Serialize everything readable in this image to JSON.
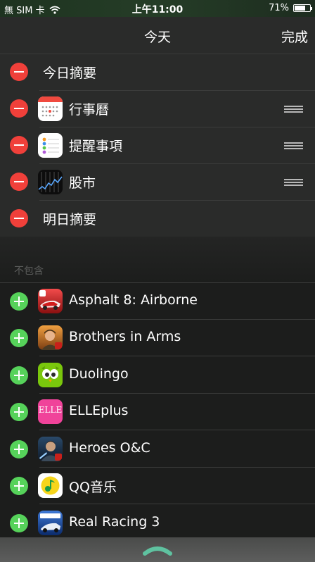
{
  "status_bar": {
    "carrier": "無 SIM 卡",
    "time": "上午11:00",
    "battery": "71%",
    "battery_level": 0.71
  },
  "nav": {
    "title": "今天",
    "done_label": "完成"
  },
  "included": [
    {
      "label": "今日摘要",
      "icon": "none",
      "reorderable": false
    },
    {
      "label": "行事曆",
      "icon": "calendar-icon",
      "reorderable": true
    },
    {
      "label": "提醒事項",
      "icon": "reminders-icon",
      "reorderable": true
    },
    {
      "label": "股市",
      "icon": "stocks-icon",
      "reorderable": true
    },
    {
      "label": "明日摘要",
      "icon": "none",
      "reorderable": false
    }
  ],
  "excluded_header": "不包含",
  "excluded": [
    {
      "label": "Asphalt 8: Airborne",
      "icon": "asphalt-8-icon"
    },
    {
      "label": "Brothers in Arms",
      "icon": "brothers-in-arms-icon"
    },
    {
      "label": "Duolingo",
      "icon": "duolingo-icon"
    },
    {
      "label": "ELLEplus",
      "icon": "elleplus-icon",
      "icon_text": "ELLE"
    },
    {
      "label": "Heroes O&C",
      "icon": "heroes-oc-icon"
    },
    {
      "label": "QQ音乐",
      "icon": "qq-music-icon"
    },
    {
      "label": "Real Racing 3",
      "icon": "real-racing-3-icon"
    }
  ],
  "colors": {
    "remove": "#f0403a",
    "add": "#56d25a",
    "panel": "#2a2b2a",
    "background": "#1c1d1c"
  }
}
